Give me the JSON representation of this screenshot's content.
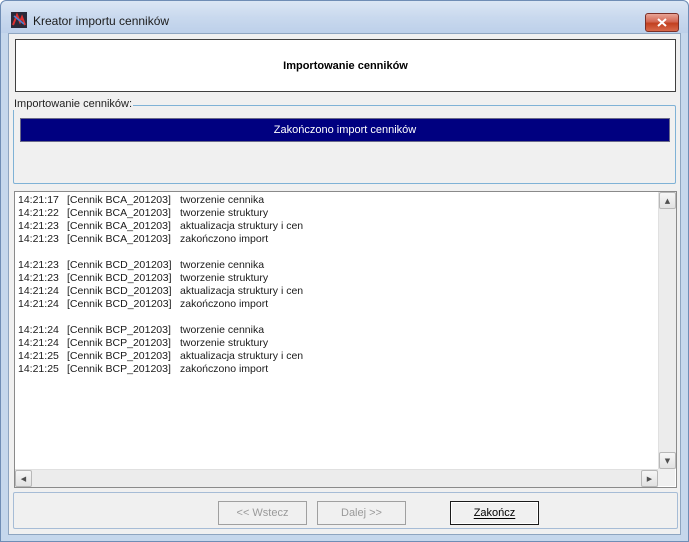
{
  "window": {
    "title": "Kreator importu cenników",
    "close_icon": "close-icon",
    "app_icon": "app-logo-icon"
  },
  "header": {
    "title": "Importowanie cenników"
  },
  "group": {
    "label": "Importowanie cenników:",
    "progress_text": "Zakończono import cenników",
    "progress_value": 1.0,
    "progress_color": "#000080"
  },
  "log": {
    "lines": [
      {
        "time": "14:21:17",
        "source": "[Cennik BCA_201203]",
        "message": "tworzenie cennika"
      },
      {
        "time": "14:21:22",
        "source": "[Cennik BCA_201203]",
        "message": "tworzenie struktury"
      },
      {
        "time": "14:21:23",
        "source": "[Cennik BCA_201203]",
        "message": "aktualizacja struktury i cen"
      },
      {
        "time": "14:21:23",
        "source": "[Cennik BCA_201203]",
        "message": "zakończono import"
      },
      {
        "time": "",
        "source": "",
        "message": ""
      },
      {
        "time": "14:21:23",
        "source": "[Cennik BCD_201203]",
        "message": "tworzenie cennika"
      },
      {
        "time": "14:21:23",
        "source": "[Cennik BCD_201203]",
        "message": "tworzenie struktury"
      },
      {
        "time": "14:21:24",
        "source": "[Cennik BCD_201203]",
        "message": "aktualizacja struktury i cen"
      },
      {
        "time": "14:21:24",
        "source": "[Cennik BCD_201203]",
        "message": "zakończono import"
      },
      {
        "time": "",
        "source": "",
        "message": ""
      },
      {
        "time": "14:21:24",
        "source": "[Cennik BCP_201203]",
        "message": "tworzenie cennika"
      },
      {
        "time": "14:21:24",
        "source": "[Cennik BCP_201203]",
        "message": "tworzenie struktury"
      },
      {
        "time": "14:21:25",
        "source": "[Cennik BCP_201203]",
        "message": "aktualizacja struktury i cen"
      },
      {
        "time": "14:21:25",
        "source": "[Cennik BCP_201203]",
        "message": "zakończono import"
      }
    ]
  },
  "buttons": {
    "back_label": "<< Wstecz",
    "next_label": "Dalej >>",
    "finish_label": "Zakończ"
  }
}
